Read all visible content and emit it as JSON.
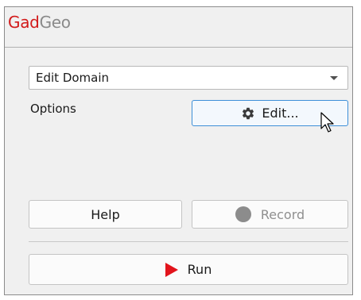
{
  "app": {
    "title_part1": "Gad",
    "title_part2": "Geo"
  },
  "domain_select": {
    "value": "Edit Domain"
  },
  "options": {
    "label": "Options",
    "edit_button": "Edit..."
  },
  "buttons": {
    "help": "Help",
    "record": "Record",
    "run": "Run"
  },
  "icons": {
    "edit": "gear-icon",
    "record": "record-circle-icon",
    "run": "play-icon",
    "dropdown": "chevron-down-icon",
    "cursor": "mouse-pointer-icon"
  },
  "colors": {
    "brand_red": "#d21a1a",
    "brand_gray": "#8a8a8a",
    "run_red": "#e2141c",
    "hover_border": "#3d8fd8"
  }
}
